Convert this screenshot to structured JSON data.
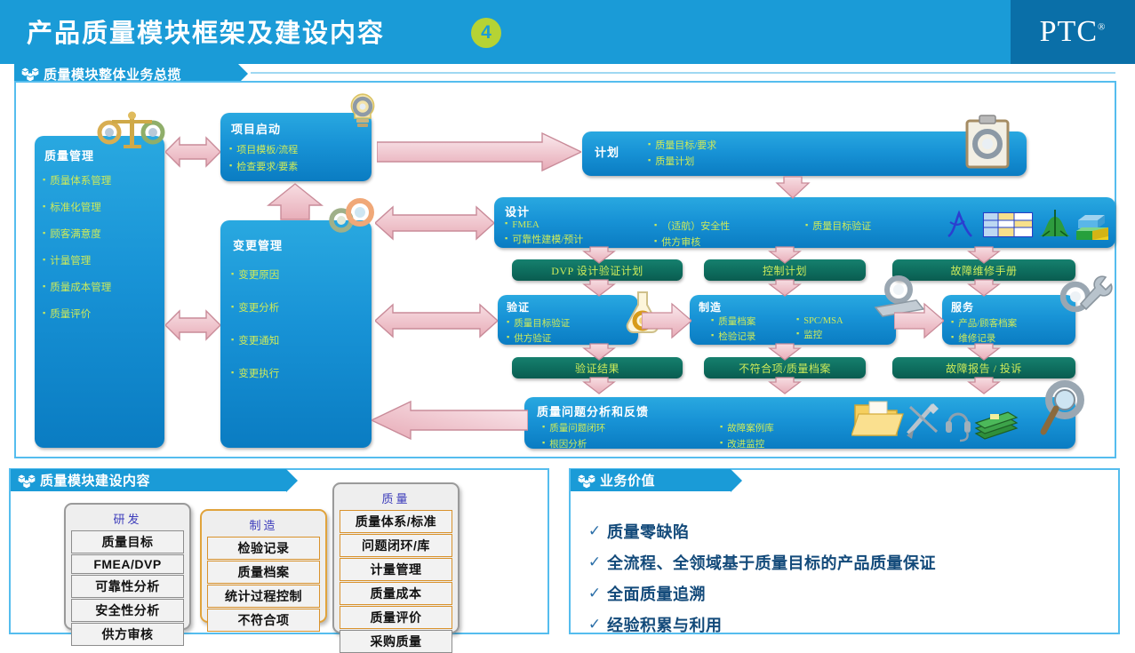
{
  "header": {
    "title": "产品质量模块框架及建设内容",
    "page_number": "4",
    "brand": "PTC",
    "brand_mark": "®",
    "band_color": "#1a9bd7",
    "brand_panel_color": "#0a6fa8",
    "number_badge_color": "#b5d334"
  },
  "sections": {
    "overview": {
      "label": "质量模块整体业务总揽"
    },
    "build": {
      "label": "质量模块建设内容"
    },
    "value": {
      "label": "业务价值"
    }
  },
  "overview": {
    "quality_management": {
      "title": "质量管理",
      "items": [
        "质量体系管理",
        "标准化管理",
        "顾客满意度",
        "计量管理",
        "质量成本管理",
        "质量评价"
      ]
    },
    "project_start": {
      "title": "项目启动",
      "items": [
        "项目模板/流程",
        "检查要求/要素"
      ]
    },
    "change_management": {
      "title": "变更管理",
      "items": [
        "变更原因",
        "变更分析",
        "变更通知",
        "变更执行"
      ]
    },
    "plan": {
      "title": "计划",
      "items": [
        "质量目标/要求",
        "质量计划"
      ]
    },
    "design": {
      "title": "设计",
      "col1": [
        "FMEA",
        "可靠性建模/预计"
      ],
      "col2": [
        "（适航）安全性",
        "供方审核"
      ],
      "col3": [
        "质量目标验证"
      ],
      "icons": [
        "lambda-curve-icon",
        "spreadsheet-icon",
        "bell-curve-icon",
        "blocks-3d-icon"
      ]
    },
    "green_top": [
      "DVP 设计验证计划",
      "控制计划",
      "故障维修手册"
    ],
    "green_bottom": [
      "验证结果",
      "不符合项/质量档案",
      "故障报告 / 投诉"
    ],
    "verify": {
      "title": "验证",
      "items": [
        "质量目标验证",
        "供方验证"
      ]
    },
    "manufacture": {
      "title": "制造",
      "col1": [
        "质量档案",
        "检验记录"
      ],
      "col2": [
        "SPC/MSA",
        "监控"
      ]
    },
    "service": {
      "title": "服务",
      "items": [
        "产品/顾客档案",
        "维修记录"
      ]
    },
    "feedback": {
      "title": "质量问题分析和反馈",
      "col1": [
        "质量问题闭环",
        "根因分析"
      ],
      "col2": [
        "故障案例库",
        "改进监控"
      ],
      "icons": [
        "folder-icon",
        "tools-icon",
        "headset-icon",
        "books-icon",
        "magnifier-gear-icon"
      ]
    },
    "decor_icons": [
      "balance-scale-gears-icon",
      "lightbulb-gear-icon",
      "gears-icon",
      "flask-gear-icon",
      "gear-conveyor-icon",
      "gear-wrench-icon",
      "clipboard-gear-icon"
    ]
  },
  "build_content": {
    "cards": [
      {
        "heading": "研发",
        "style": "gray",
        "rows": [
          "质量目标",
          "FMEA/DVP",
          "可靠性分析",
          "安全性分析",
          "供方审核"
        ]
      },
      {
        "heading": "制造",
        "style": "orange",
        "rows": [
          "检验记录",
          "质量档案",
          "统计过程控制",
          "不符合项"
        ]
      },
      {
        "heading": "质量",
        "style": "gray",
        "rows": [
          "质量体系/标准",
          "问题闭环/库",
          "计量管理",
          "质量成本",
          "质量评价",
          "采购质量"
        ]
      }
    ]
  },
  "business_value": {
    "check_mark": "✓",
    "items": [
      "质量零缺陷",
      "全流程、全领域基于质量目标的产品质量保证",
      "全面质量追溯",
      "经验积累与利用"
    ]
  }
}
